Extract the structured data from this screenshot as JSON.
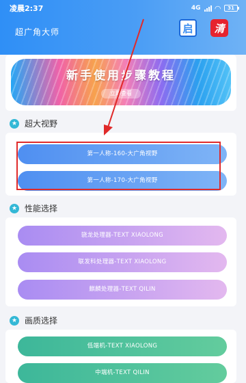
{
  "status_bar": {
    "time": "凌晨2:37",
    "network": "4G",
    "battery": "31"
  },
  "header": {
    "title": "超广角大师",
    "start_label": "启",
    "clean_label": "清"
  },
  "banner": {
    "title": "新手使用步骤教程",
    "button": "立即查看"
  },
  "sections": {
    "wide_view": {
      "title": "超大视野",
      "items": [
        "第一人称-160-大广角视野",
        "第一人称-170-大广角视野"
      ]
    },
    "performance": {
      "title": "性能选择",
      "items": [
        "骁龙处理器-TEXT XIAOLONG",
        "联发科处理器-TEXT XIAOLONG",
        "麒麟处理器-TEXT QILIN"
      ]
    },
    "quality": {
      "title": "画质选择",
      "items": [
        "低端机-TEXT XIAOLONG",
        "中端机-TEXT QILIN"
      ]
    }
  },
  "colors": {
    "header": "#3b93f5",
    "annotation": "#e02a2a",
    "star": "#34b8d6"
  }
}
